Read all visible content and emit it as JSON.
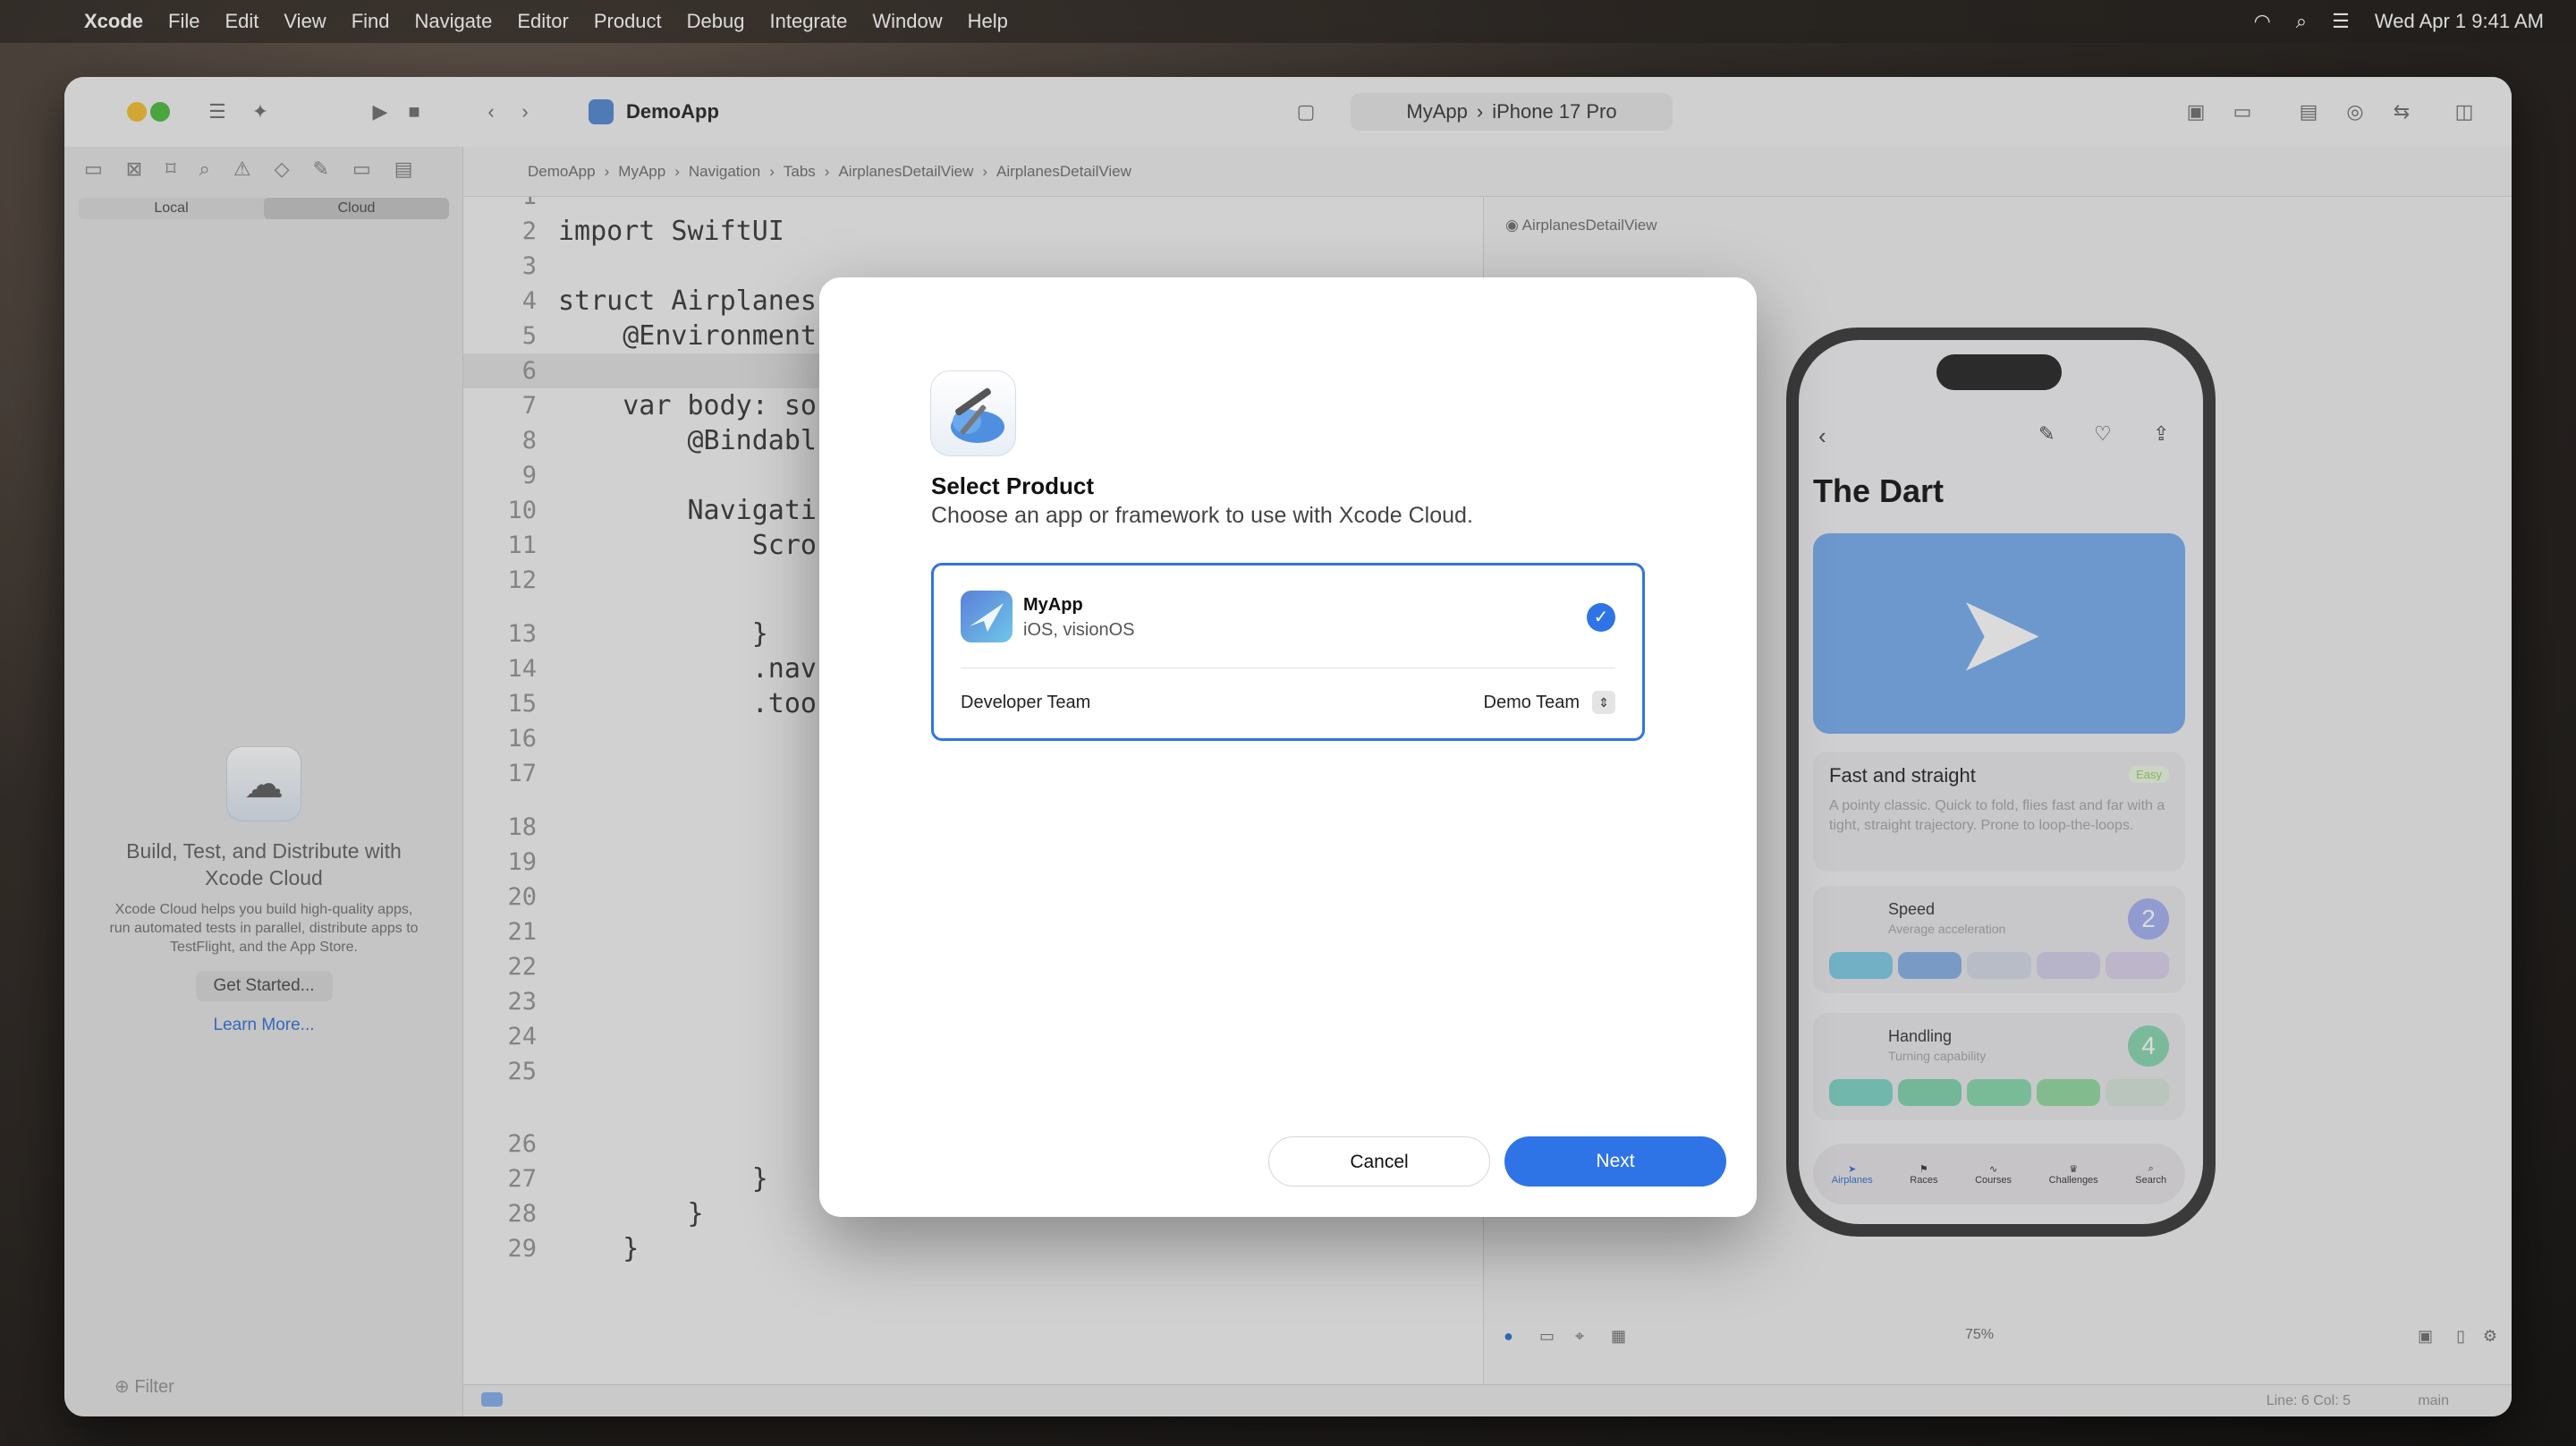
{
  "menubar": {
    "app": "Xcode",
    "items": [
      "File",
      "Edit",
      "View",
      "Find",
      "Navigate",
      "Editor",
      "Product",
      "Debug",
      "Integrate",
      "Window",
      "Help"
    ],
    "clock": "Wed Apr 1  9:41 AM"
  },
  "toolbar": {
    "project": "DemoApp",
    "scheme": "MyApp",
    "destination": "iPhone 17 Pro"
  },
  "jumpbar": [
    "DemoApp",
    "MyApp",
    "Navigation",
    "Tabs",
    "AirplanesDetailView",
    "AirplanesDetailView"
  ],
  "sidebar": {
    "seg_local": "Local",
    "seg_cloud": "Cloud",
    "promo_title": "Build, Test, and Distribute with Xcode Cloud",
    "promo_body": "Xcode Cloud helps you build high-quality apps, run automated tests in parallel, distribute apps to TestFlight, and the App Store.",
    "get_started": "Get Started...",
    "learn_more": "Learn More...",
    "filter_placeholder": "Filter"
  },
  "editor": {
    "lines": [
      {
        "n": "1",
        "t": ""
      },
      {
        "n": "2",
        "t": "import SwiftUI"
      },
      {
        "n": "3",
        "t": ""
      },
      {
        "n": "4",
        "t": "struct Airplanes"
      },
      {
        "n": "5",
        "t": "    @Environment"
      },
      {
        "n": "6",
        "t": ""
      },
      {
        "n": "7",
        "t": "    var body: so"
      },
      {
        "n": "8",
        "t": "        @Bindabl"
      },
      {
        "n": "9",
        "t": ""
      },
      {
        "n": "10",
        "t": "        Navigati"
      },
      {
        "n": "11",
        "t": "            Scro"
      },
      {
        "n": "12",
        "t": ""
      },
      {
        "n": "13",
        "t": "            }"
      },
      {
        "n": "14",
        "t": "            .nav"
      },
      {
        "n": "15",
        "t": "            .too"
      },
      {
        "n": "16",
        "t": ""
      },
      {
        "n": "17",
        "t": ""
      },
      {
        "n": "18",
        "t": ""
      },
      {
        "n": "19",
        "t": ""
      },
      {
        "n": "20",
        "t": ""
      },
      {
        "n": "21",
        "t": ""
      },
      {
        "n": "22",
        "t": ""
      },
      {
        "n": "23",
        "t": ""
      },
      {
        "n": "24",
        "t": ""
      },
      {
        "n": "25",
        "t": ""
      },
      {
        "n": "26",
        "t": "                }"
      },
      {
        "n": "27",
        "t": "            }"
      },
      {
        "n": "28",
        "t": "        }"
      },
      {
        "n": "29",
        "t": "    }"
      }
    ]
  },
  "canvas": {
    "preview_label": "AirplanesDetailView",
    "zoom": "75%",
    "status": "Line: 6  Col: 5",
    "branch": "main",
    "phone": {
      "title": "The Dart",
      "card_title": "Fast and straight",
      "card_badge": "Easy",
      "card_body": "A pointy classic. Quick to fold, flies fast and far with a tight, straight trajectory. Prone to loop-the-loops.",
      "speed_label": "Speed",
      "speed_sub": "Average acceleration",
      "speed_value": "2",
      "handling_label": "Handling",
      "handling_sub": "Turning capability",
      "handling_value": "4",
      "tabs": [
        "Airplanes",
        "Races",
        "Courses",
        "Challenges",
        "Search"
      ]
    }
  },
  "dialog": {
    "title": "Select Product",
    "subtitle": "Choose an app or framework to use with Xcode Cloud.",
    "product_name": "MyApp",
    "product_platforms": "iOS, visionOS",
    "team_label": "Developer Team",
    "team_value": "Demo Team",
    "cancel": "Cancel",
    "next": "Next"
  },
  "colors": {
    "accent": "#2f74e6"
  }
}
